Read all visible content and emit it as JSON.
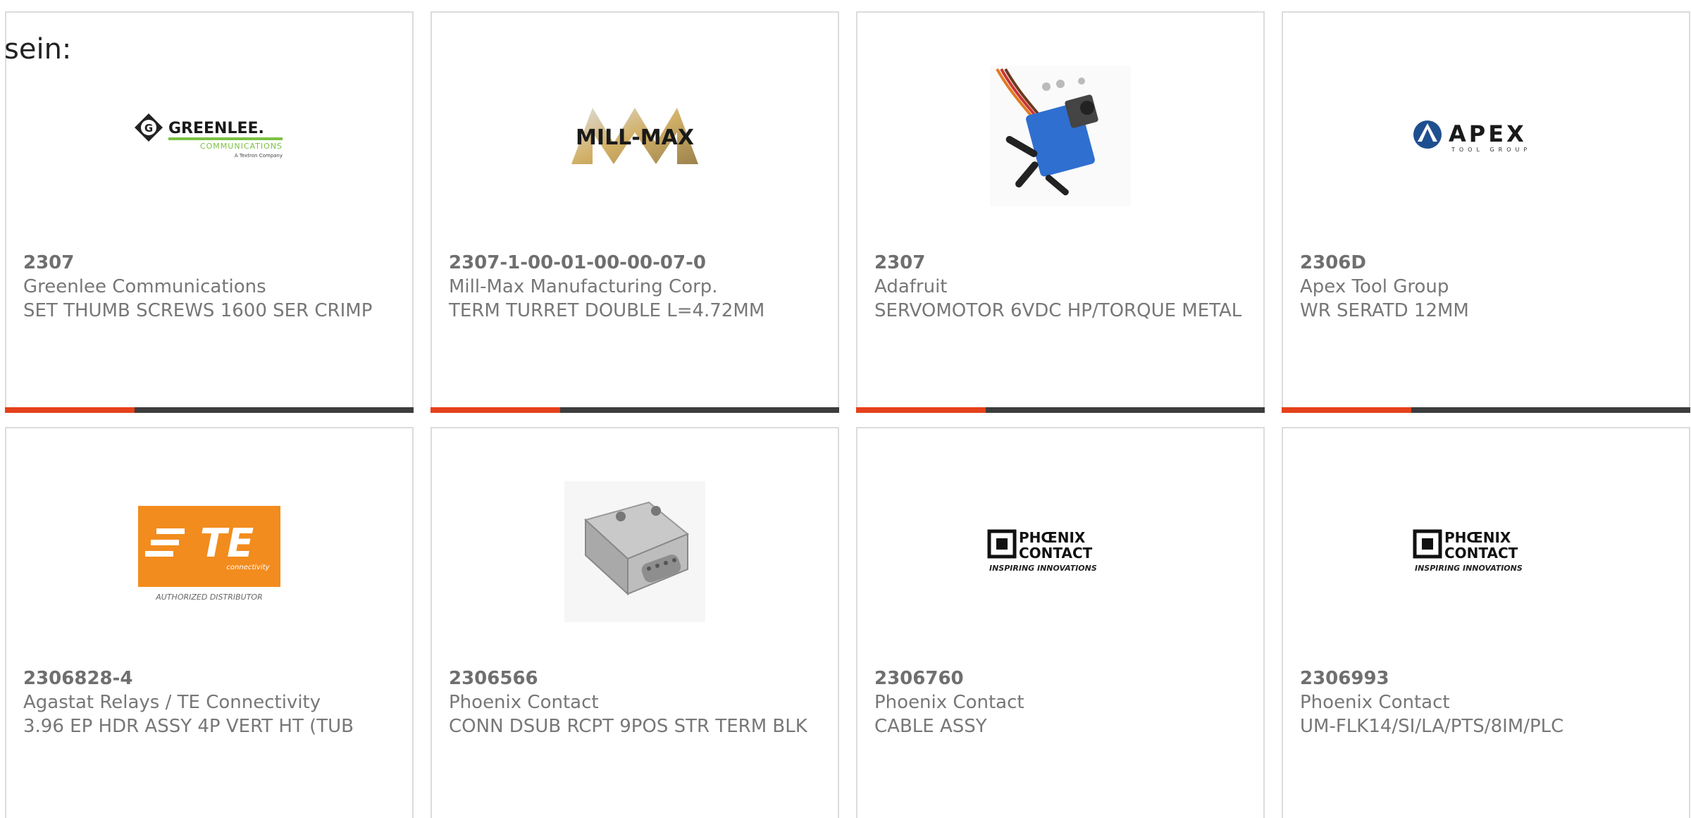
{
  "intro": "sein:",
  "colors": {
    "accent": "#e5411a",
    "bar": "#3d3d3d",
    "border": "#dcdcdc",
    "text": "#777777"
  },
  "products": [
    {
      "part": "2307",
      "maker": "Greenlee Communications",
      "desc": "SET THUMB SCREWS 1600 SER CRIMP",
      "image": "greenlee-logo"
    },
    {
      "part": "2307-1-00-01-00-00-07-0",
      "maker": "Mill-Max Manufacturing Corp.",
      "desc": "TERM TURRET DOUBLE L=4.72MM",
      "image": "mill-max-logo"
    },
    {
      "part": "2307",
      "maker": "Adafruit",
      "desc": "SERVOMOTOR 6VDC HP/TORQUE METAL",
      "image": "servo-photo"
    },
    {
      "part": "2306D",
      "maker": "Apex Tool Group",
      "desc": "WR SERATD 12MM",
      "image": "apex-logo"
    },
    {
      "part": "2306828-4",
      "maker": "Agastat Relays / TE Connectivity",
      "desc": "3.96 EP HDR ASSY 4P VERT HT (TUB",
      "image": "te-logo"
    },
    {
      "part": "2306566",
      "maker": "Phoenix Contact",
      "desc": "CONN DSUB RCPT 9POS STR TERM BLK",
      "image": "dsub-photo"
    },
    {
      "part": "2306760",
      "maker": "Phoenix Contact",
      "desc": "CABLE ASSY",
      "image": "phoenix-logo"
    },
    {
      "part": "2306993",
      "maker": "Phoenix Contact",
      "desc": "UM-FLK14/SI/LA/PTS/8IM/PLC",
      "image": "phoenix-logo"
    }
  ],
  "logos": {
    "greenlee": {
      "name": "GREENLEE.",
      "sub": "COMMUNICATIONS",
      "tag": "A Textron Company"
    },
    "millmax": {
      "name": "MILL-MAX"
    },
    "apex": {
      "name": "APEX",
      "sub": "TOOL GROUP"
    },
    "te": {
      "name": "TE",
      "sub": "connectivity",
      "tag": "AUTHORIZED DISTRIBUTOR"
    },
    "phoenix": {
      "name1": "PHŒNIX",
      "name2": "CONTACT",
      "tag": "INSPIRING INNOVATIONS"
    }
  }
}
